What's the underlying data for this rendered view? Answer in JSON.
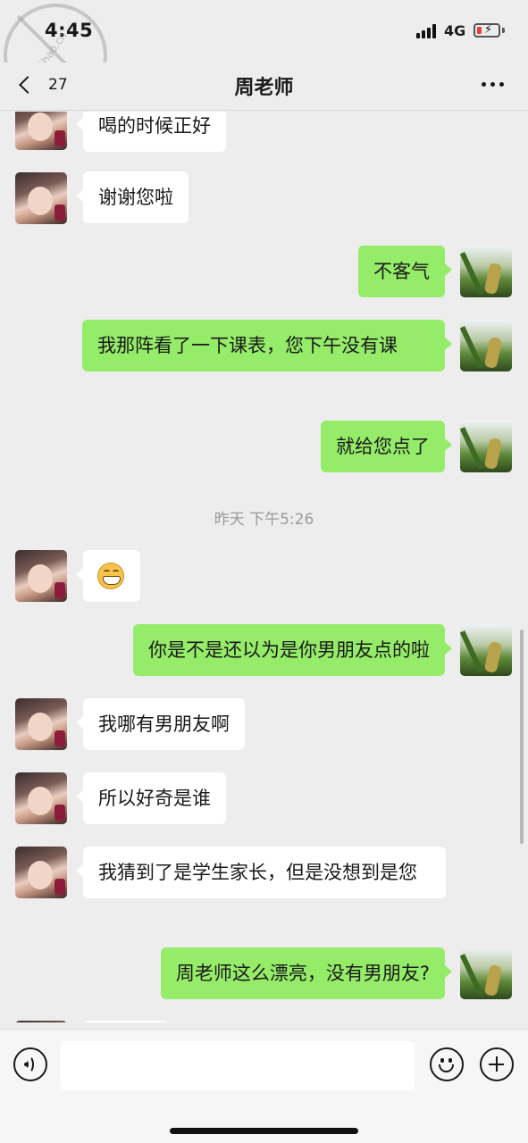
{
  "status_bar": {
    "time": "4:45",
    "network": "4G",
    "battery_bolt": "⚡"
  },
  "watermark": {
    "text": "haihao.cn"
  },
  "header": {
    "back_count": "27",
    "title": "周老师"
  },
  "messages": [
    {
      "side": "left",
      "text": "喝的时候正好"
    },
    {
      "side": "left",
      "text": "谢谢您啦"
    },
    {
      "side": "right",
      "text": "不客气"
    },
    {
      "side": "right",
      "text": "我那阵看了一下课表，您下午没有课"
    },
    {
      "side": "right",
      "text": "就给您点了"
    },
    {
      "type": "timestamp",
      "text": "昨天 下午5:26"
    },
    {
      "side": "left",
      "type": "emoji",
      "emoji": "grinning-face"
    },
    {
      "side": "right",
      "text": "你是不是还以为是你男朋友点的啦"
    },
    {
      "side": "left",
      "text": "我哪有男朋友啊"
    },
    {
      "side": "left",
      "text": "所以好奇是谁"
    },
    {
      "side": "left",
      "text": "我猜到了是学生家长，但是没想到是您"
    },
    {
      "side": "right",
      "text": "周老师这么漂亮，没有男朋友?"
    }
  ],
  "input_bar": {
    "placeholder": ""
  },
  "colors": {
    "background": "#ededed",
    "bubble_sent": "#95ec69",
    "bubble_received": "#ffffff"
  }
}
